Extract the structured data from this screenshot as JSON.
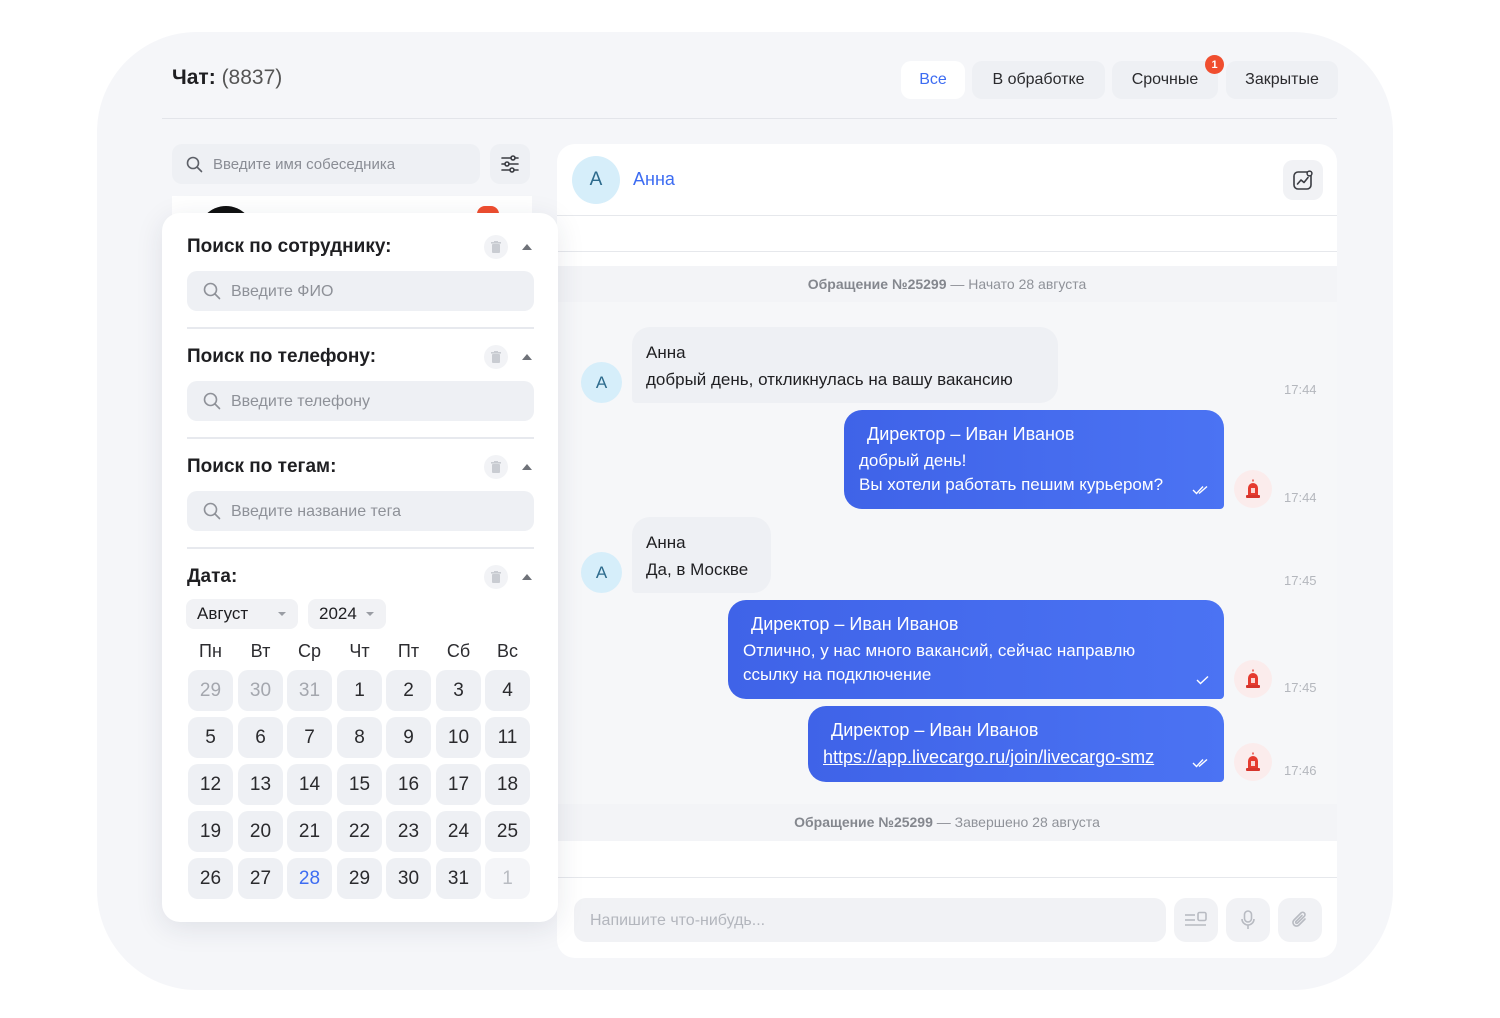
{
  "header": {
    "title_label": "Чат:",
    "title_count": "(8837)",
    "tabs": [
      {
        "label": "Все"
      },
      {
        "label": "В обработке"
      },
      {
        "label": "Срочные",
        "badge": "1"
      },
      {
        "label": "Закрытые"
      }
    ]
  },
  "sidebar": {
    "search_placeholder": "Введите имя собеседника"
  },
  "filter_panel": {
    "employee": {
      "title": "Поиск по сотруднику:",
      "placeholder": "Введите ФИО"
    },
    "phone": {
      "title": "Поиск по телефону:",
      "placeholder": "Введите телефону"
    },
    "tags": {
      "title": "Поиск по тегам:",
      "placeholder": "Введите название тега"
    },
    "date": {
      "title": "Дата:",
      "month": "Август",
      "year": "2024",
      "weekdays": [
        "Пн",
        "Вт",
        "Ср",
        "Чт",
        "Пт",
        "Сб",
        "Вс"
      ],
      "weeks": [
        [
          "29",
          "30",
          "31",
          "1",
          "2",
          "3",
          "4"
        ],
        [
          "5",
          "6",
          "7",
          "8",
          "9",
          "10",
          "11"
        ],
        [
          "12",
          "13",
          "14",
          "15",
          "16",
          "17",
          "18"
        ],
        [
          "19",
          "20",
          "21",
          "22",
          "23",
          "24",
          "25"
        ],
        [
          "26",
          "27",
          "28",
          "29",
          "30",
          "31",
          "1"
        ]
      ],
      "selected_day": "28"
    }
  },
  "chat": {
    "contact": {
      "initial": "А",
      "name": "Анна"
    },
    "ticket_start": {
      "number": "Обращение №25299",
      "status": " — Начато 28 августа"
    },
    "ticket_end": {
      "number": "Обращение №25299",
      "status": " — Завершено 28 августа"
    },
    "messages": [
      {
        "sender": "Анна",
        "text": "добрый день, откликнулась на вашу вакансию",
        "time": "17:44"
      },
      {
        "sender": "Директор – Иван Иванов",
        "text": "добрый день!",
        "text2": "Вы хотели работать пешим курьером?",
        "time": "17:44"
      },
      {
        "sender": "Анна",
        "text": "Да, в Москве",
        "time": "17:45"
      },
      {
        "sender": "Директор – Иван Иванов",
        "text": "Отлично, у нас много вакансий, сейчас направлю",
        "text2": "ссылку на подключение",
        "time": "17:45"
      },
      {
        "sender": "Директор – Иван Иванов",
        "link": "https://app.livecargo.ru/join/livecargo-smz",
        "time": "17:46"
      }
    ],
    "compose_placeholder": "Напишите что-нибудь..."
  },
  "colors": {
    "accent": "#3d6cf2",
    "badge": "#f04e2f",
    "outgoing_bubble": "#4468ec",
    "incoming_bubble": "#eef0f4",
    "avatar_bg": "#d6eefa"
  },
  "icons": [
    "search-icon",
    "filter-sliders-icon",
    "trash-icon",
    "chevron-up-icon",
    "chart-icon",
    "double-check-icon",
    "check-icon",
    "siren-icon",
    "template-icon",
    "microphone-icon",
    "paperclip-icon"
  ]
}
